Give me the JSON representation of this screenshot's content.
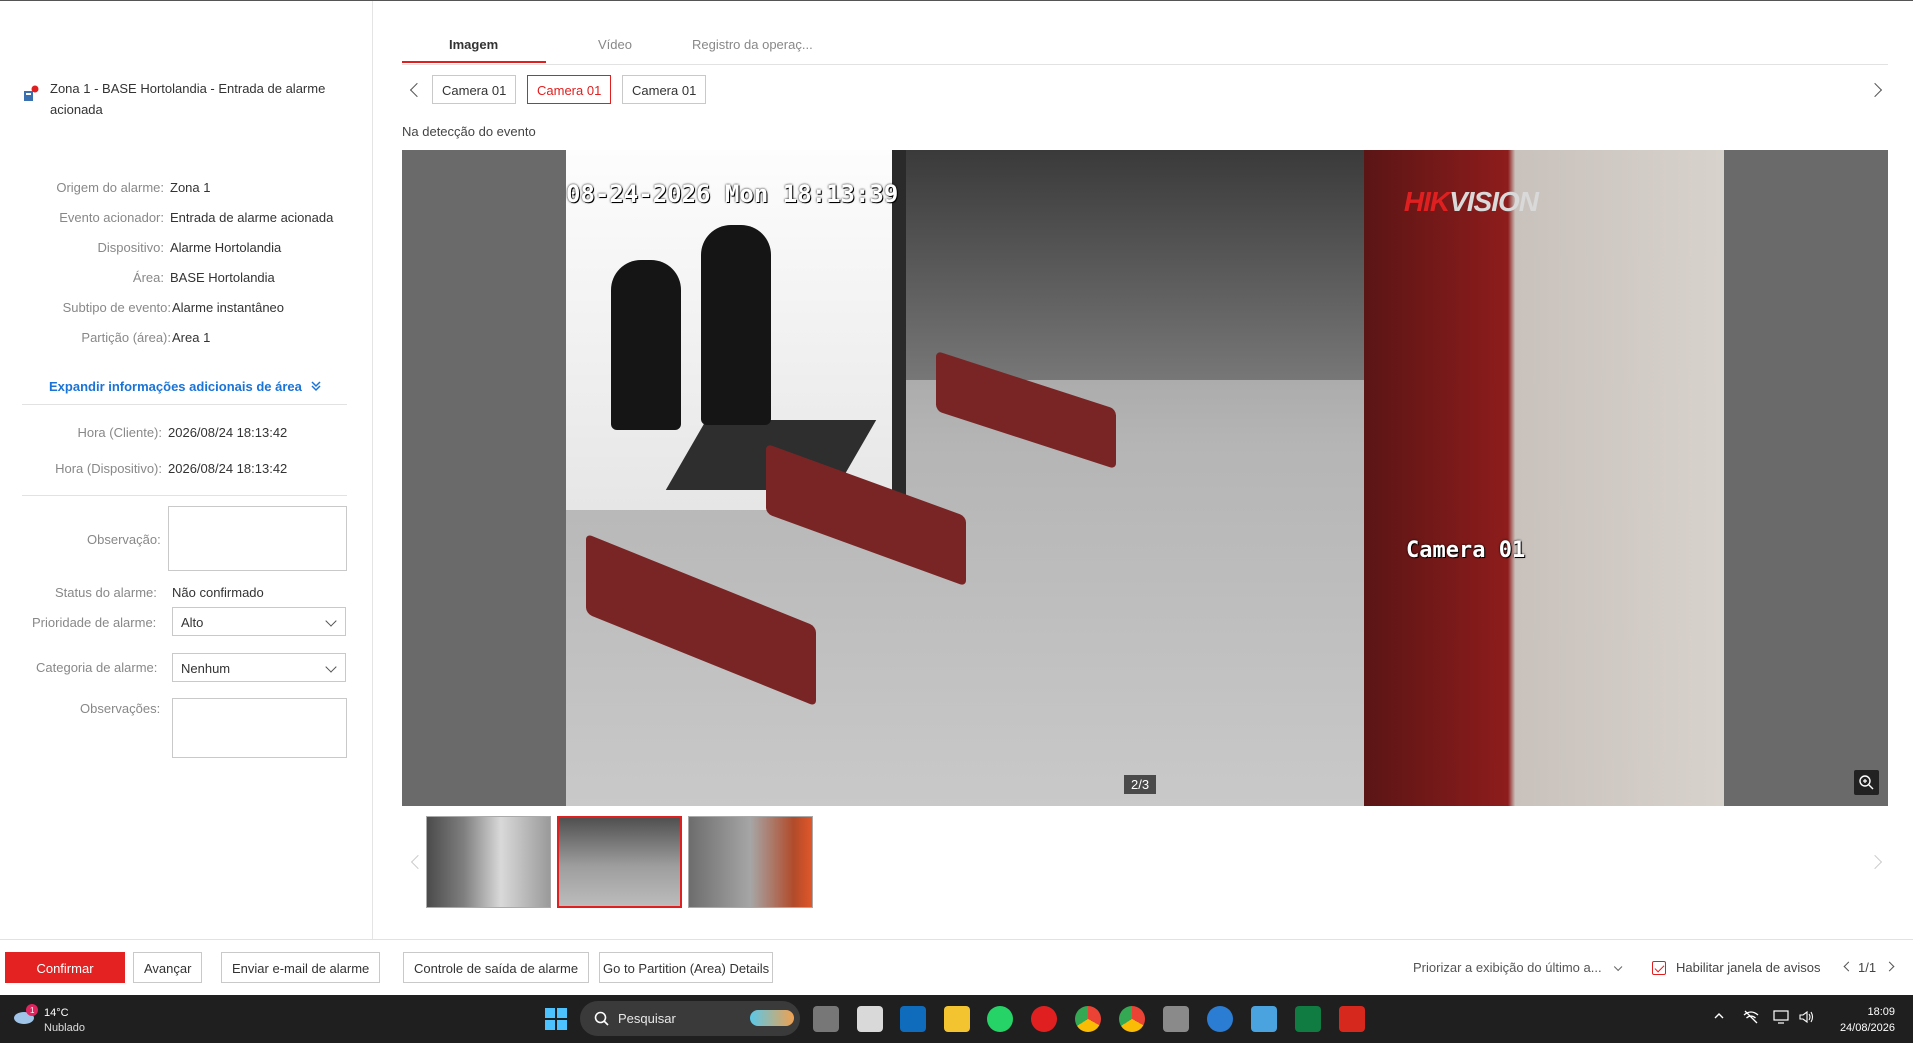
{
  "alarm": {
    "title": "Zona 1 - BASE Hortolandia - Entrada de alarme acionada"
  },
  "details": [
    {
      "label": "Origem do alarme:",
      "value": "Zona 1"
    },
    {
      "label": "Evento acionador:",
      "value": "Entrada de alarme acionada"
    },
    {
      "label": "Dispositivo:",
      "value": "Alarme Hortolandia"
    },
    {
      "label": "Área:",
      "value": "BASE Hortolandia"
    },
    {
      "label": "Subtipo de evento:",
      "value": "Alarme instantâneo"
    },
    {
      "label": "Partição (área):",
      "value": "Area 1"
    }
  ],
  "expand_label": "Expandir informações adicionais de área",
  "times": [
    {
      "label": "Hora (Cliente):",
      "value": "2026/08/24 18:13:42"
    },
    {
      "label": "Hora (Dispositivo):",
      "value": "2026/08/24 18:13:42"
    }
  ],
  "form": {
    "observacao_label": "Observação:",
    "status_label": "Status do alarme:",
    "status_value": "Não confirmado",
    "prioridade_label": "Prioridade de alarme:",
    "prioridade_value": "Alto",
    "categoria_label": "Categoria de alarme:",
    "categoria_value": "Nenhum",
    "observacoes_label": "Observações:"
  },
  "tabs": [
    "Imagem",
    "Vídeo",
    "Registro da operaç..."
  ],
  "cameras": [
    "Camera 01",
    "Camera 01",
    "Camera 01"
  ],
  "caption": "Na detecção do evento",
  "viewer": {
    "osd_time": "08-24-2026 Mon 18:13:39",
    "osd_camera": "Camera 01",
    "brand_hik": "HIK",
    "brand_vision": "VISION",
    "counter": "2/3"
  },
  "bottom": {
    "confirm": "Confirmar",
    "next": "Avançar",
    "email": "Enviar e-mail de alarme",
    "output": "Controle de saída de alarme",
    "partition": "Go to Partition (Area) Details",
    "priority": "Priorizar a exibição do último a...",
    "enable_popup": "Habilitar janela de avisos",
    "pager": "1/1"
  },
  "taskbar": {
    "temp": "14°C",
    "weather": "Nublado",
    "weather_badge": "1",
    "search": "Pesquisar",
    "time": "18:09",
    "date": "24/08/2026"
  },
  "colors": {
    "accent": "#e02020",
    "link": "#1a73d6"
  }
}
